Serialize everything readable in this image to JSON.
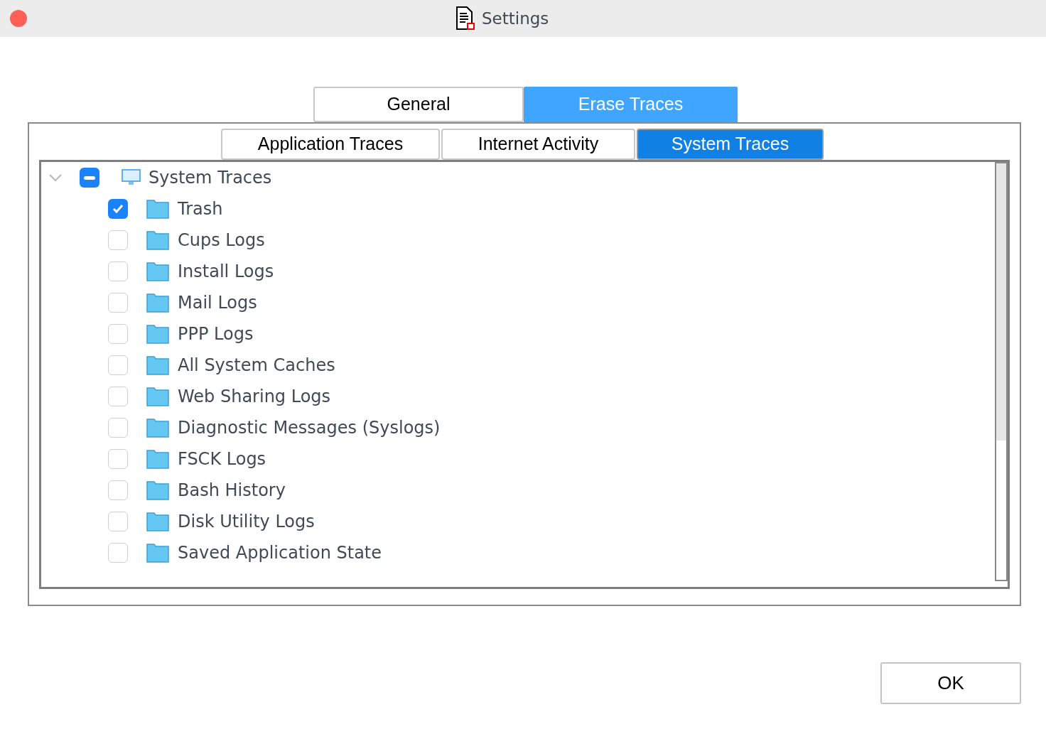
{
  "window": {
    "title": "Settings"
  },
  "tabs": [
    {
      "label": "General",
      "selected": false
    },
    {
      "label": "Erase Traces",
      "selected": true
    }
  ],
  "subtabs": [
    {
      "label": "Application Traces",
      "selected": false
    },
    {
      "label": "Internet Activity",
      "selected": false
    },
    {
      "label": "System Traces",
      "selected": true
    }
  ],
  "tree": {
    "label": "System Traces",
    "expanded": true,
    "mixed": true,
    "children": [
      {
        "label": "Trash",
        "checked": true
      },
      {
        "label": "Cups Logs",
        "checked": false
      },
      {
        "label": "Install Logs",
        "checked": false
      },
      {
        "label": "Mail Logs",
        "checked": false
      },
      {
        "label": "PPP Logs",
        "checked": false
      },
      {
        "label": "All System Caches",
        "checked": false
      },
      {
        "label": "Web Sharing Logs",
        "checked": false
      },
      {
        "label": "Diagnostic Messages (Syslogs)",
        "checked": false
      },
      {
        "label": "FSCK Logs",
        "checked": false
      },
      {
        "label": "Bash History",
        "checked": false
      },
      {
        "label": "Disk Utility Logs",
        "checked": false
      },
      {
        "label": "Saved Application State",
        "checked": false
      }
    ]
  },
  "buttons": [
    "OK"
  ]
}
